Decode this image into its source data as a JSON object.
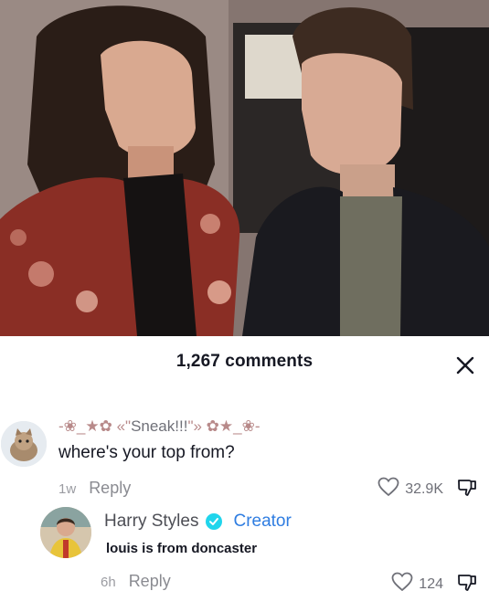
{
  "comments_header": {
    "count_label": "1,267 comments"
  },
  "comments": [
    {
      "username_deco_left": "-❀_★✿ «\"",
      "username_core": "Sneak!!!",
      "username_deco_right": "\"» ✿★_❀-",
      "text": "where's your top from?",
      "time": "1w",
      "reply_label": "Reply",
      "likes": "32.9K"
    },
    {
      "username": "Harry Styles",
      "badge": "Creator",
      "text": "louis is from doncaster",
      "time": "6h",
      "reply_label": "Reply",
      "likes": "124"
    }
  ],
  "icons": {
    "close": "close-icon",
    "like": "heart-outline-icon",
    "dislike": "thumbs-down-icon",
    "verified": "verified-badge-icon"
  },
  "colors": {
    "creator": "#2f7de1",
    "verified": "#20d5ec",
    "text": "#161823",
    "muted": "#8a8b91"
  }
}
